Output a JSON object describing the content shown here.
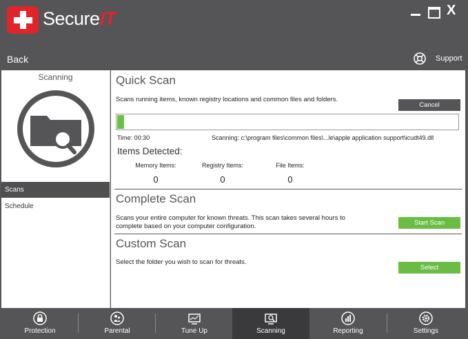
{
  "app": {
    "brand_main": "Secure",
    "brand_accent": "IT",
    "window_controls": {
      "close": "X"
    },
    "back_label": "Back",
    "support_label": "Support"
  },
  "sidebar": {
    "title": "Scanning",
    "items": [
      {
        "label": "Scans",
        "active": true
      },
      {
        "label": "Schedule",
        "active": false
      }
    ]
  },
  "quick_scan": {
    "title": "Quick Scan",
    "description": "Scans running items, known registry locations and common files and folders.",
    "button_label": "Cancel",
    "progress": 0.02,
    "time_label": "Time: 00:30",
    "scanning_label": "Scanning: c:\\program files\\common files\\...le\\apple application support\\icudt49.dll",
    "items_detected_title": "Items Detected:",
    "counters": [
      {
        "label": "Memory Items:",
        "value": "0"
      },
      {
        "label": "Registry Items:",
        "value": "0"
      },
      {
        "label": "File Items:",
        "value": "0"
      }
    ]
  },
  "complete_scan": {
    "title": "Complete Scan",
    "description_line1": "Scans your entire computer for known threats. This scan takes several hours to",
    "description_line2": "complete based on your computer configuration.",
    "button_label": "Start Scan"
  },
  "custom_scan": {
    "title": "Custom Scan",
    "description": "Select the folder you wish to scan for threats.",
    "button_label": "Select"
  },
  "bottom_tabs": [
    {
      "label": "Protection",
      "icon": "lock-icon",
      "active": false
    },
    {
      "label": "Parental",
      "icon": "parents-icon",
      "active": false
    },
    {
      "label": "Tune Up",
      "icon": "monitor-icon",
      "active": false
    },
    {
      "label": "Scanning",
      "icon": "scan-icon",
      "active": true
    },
    {
      "label": "Reporting",
      "icon": "report-icon",
      "active": false
    },
    {
      "label": "Settings",
      "icon": "gear-icon",
      "active": false
    }
  ],
  "colors": {
    "brand_red": "#e0242a",
    "accent_green": "#69bd45",
    "chrome_gray": "#555557"
  }
}
